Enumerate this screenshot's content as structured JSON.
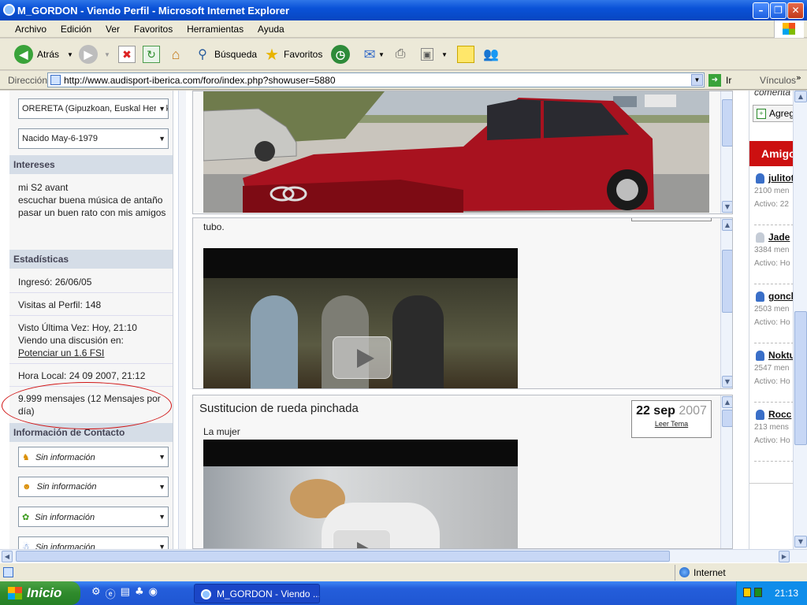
{
  "window": {
    "title": "M_GORDON - Viendo Perfil - Microsoft Internet Explorer"
  },
  "menu": [
    "Archivo",
    "Edición",
    "Ver",
    "Favoritos",
    "Herramientas",
    "Ayuda"
  ],
  "toolbar": {
    "back": "Atrás",
    "search": "Búsqueda",
    "favorites": "Favoritos"
  },
  "address": {
    "label": "Dirección",
    "url": "http://www.audisport-iberica.com/foro/index.php?showuser=5880",
    "go": "Ir",
    "links": "Vínculos"
  },
  "profile": {
    "location": "ORERETA (Gipuzkoan, Euskal Herritik)",
    "born": "Nacido May-6-1979",
    "interests_title": "Intereses",
    "interests": [
      "mi S2 avant",
      "escuchar buena música de antaño",
      "pasar un buen rato con mis amigos"
    ],
    "stats_title": "Estadísticas",
    "joined": "Ingresó: 26/06/05",
    "visits": "Visitas al Perfil: 148",
    "last_seen": "Visto Última Vez: Hoy, 21:10",
    "viewing": "Viendo una discusión en:",
    "viewing_link": "Potenciar un 1.6 FSI",
    "local_time": "Hora Local: 24 09 2007, 21:12",
    "posts": "9.999 mensajes (12 Mensajes por día)",
    "contact_title": "Información de Contacto",
    "contact_value": "Sin información"
  },
  "posts": [
    {
      "excerpt": "tubo."
    },
    {
      "title": "Sustitucion de rueda pinchada",
      "day": "22 sep",
      "year": "2007",
      "read_more": "Leer Tema",
      "excerpt": "La mujer"
    }
  ],
  "sidebar_right": {
    "comments": "comenta",
    "add": "Agreg",
    "friends_title": "Amigo",
    "friends": [
      {
        "name": "julitot",
        "posts": "2100 men",
        "active": "Activo: 22"
      },
      {
        "name": "Jade",
        "posts": "3384 men",
        "active": "Activo: Ho"
      },
      {
        "name": "goncl",
        "posts": "2503 men",
        "active": "Activo: Ho"
      },
      {
        "name": "Noktu",
        "posts": "2547 men",
        "active": "Activo: Ho"
      },
      {
        "name": "Rocc",
        "posts": "213 mens",
        "active": "Activo: Ho"
      }
    ]
  },
  "status": {
    "zone": "Internet"
  },
  "taskbar": {
    "start": "Inicio",
    "item": "M_GORDON - Viendo ...",
    "clock": "21:13"
  },
  "colors": {
    "titlebar": "#0a52d8",
    "amigos_header": "#cc1010",
    "annotation": "#d01515",
    "start": "#2f8a2c"
  }
}
